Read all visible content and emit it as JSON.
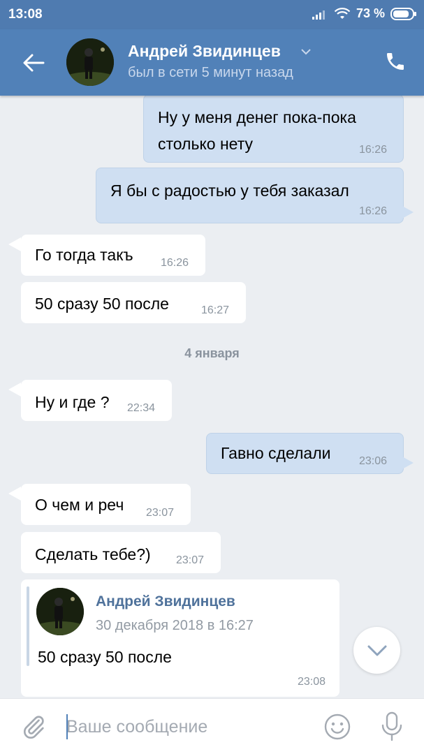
{
  "statusbar": {
    "time": "13:08",
    "battery": "73 %"
  },
  "header": {
    "contact_name": "Андрей Звидинцев",
    "contact_status": "был в сети 5 минут назад"
  },
  "messages": [
    {
      "direction": "out",
      "text": "Ну у меня денег пока-пока\nстолько нету",
      "time": "16:26"
    },
    {
      "direction": "out",
      "text": "Я бы с радостью у тебя заказал",
      "time": "16:26"
    },
    {
      "direction": "in",
      "text": "Го тогда такъ",
      "time": "16:26"
    },
    {
      "direction": "in",
      "text": "50 сразу 50 после",
      "time": "16:27"
    },
    {
      "direction": "in",
      "text": "Ну и где ?",
      "time": "22:34"
    },
    {
      "direction": "out",
      "text": "Гавно сделали",
      "time": "23:06"
    },
    {
      "direction": "in",
      "text": "О чем и реч",
      "time": "23:07"
    },
    {
      "direction": "in",
      "text": "Сделать тебе?)",
      "time": "23:07"
    }
  ],
  "date_separator": "4 января",
  "forwarded": {
    "author": "Андрей Звидинцев",
    "date": "30 декабря 2018 в 16:27",
    "text": "50 сразу 50 после",
    "time": "23:08"
  },
  "composer": {
    "placeholder": "Ваше сообщение"
  },
  "colors": {
    "header": "#5181b8",
    "statusbar": "#4f7bb0",
    "outgoing_bubble": "#cfdff2",
    "incoming_bubble": "#ffffff",
    "background": "#ebeef2"
  }
}
